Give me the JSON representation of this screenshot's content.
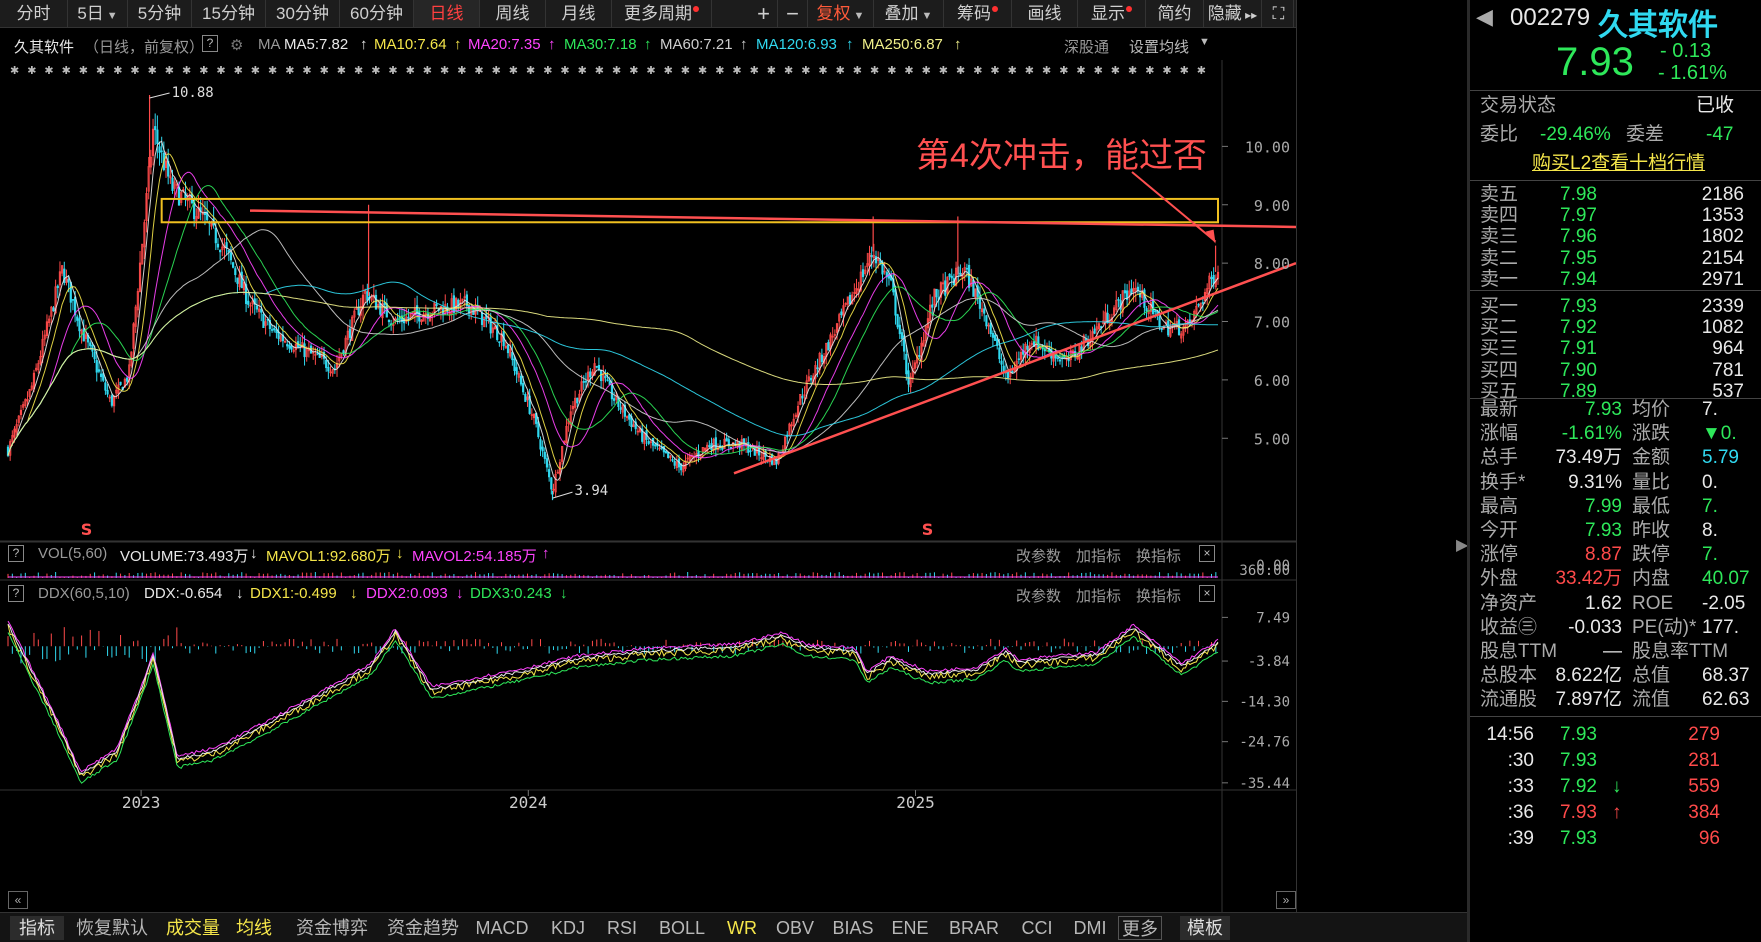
{
  "toolbar": {
    "periods": [
      "分时",
      "5日",
      "5分钟",
      "15分钟",
      "30分钟",
      "60分钟",
      "日线",
      "周线",
      "月线",
      "更多周期"
    ],
    "active": "日线",
    "tools": [
      "+",
      "−",
      "复权",
      "叠加",
      "筹码",
      "画线",
      "显示",
      "简约",
      "隐藏"
    ]
  },
  "legend": {
    "name": "久其软件",
    "mode": "（日线，前复权）",
    "help": "?",
    "ma_label": "MA",
    "ma5": "MA5:7.82",
    "ma10": "MA10:7.64",
    "ma20": "MA20:7.35",
    "ma30": "MA30:7.18",
    "ma60": "MA60:7.21",
    "ma120": "MA120:6.93",
    "ma250": "MA250:6.87",
    "up_arrow": "↑",
    "link1": "深股通",
    "link2": "设置均线"
  },
  "colors": {
    "ma5": "#e8e8e8",
    "ma10": "#f5e64a",
    "ma20": "#ff44ff",
    "ma30": "#2ee85a",
    "ma60": "#cfcfcf",
    "ma120": "#30d9f0",
    "ma250": "#f0f08a",
    "up": "#ff4a4a",
    "down": "#30d9f0",
    "annotation": "#ff5050",
    "box": "#f0c020"
  },
  "annotation": {
    "text": "第4次冲击，能过否",
    "high_label": "10.88",
    "low_label": "3.94",
    "event_marker": "S"
  },
  "price_axis": [
    "10.00",
    "9.00",
    "8.00",
    "7.00",
    "6.00",
    "5.00"
  ],
  "time_axis": [
    "2023",
    "2024",
    "2025"
  ],
  "vol_panel": {
    "help": "?",
    "name": "VOL(5,60)",
    "volume": "VOLUME:73.493万",
    "mavol1": "MAVOL1:92.680万",
    "mavol2": "MAVOL2:54.185万",
    "down_arrow": "↓",
    "up_arrow": "↑",
    "btn1": "改参数",
    "btn2": "加指标",
    "btn3": "换指标",
    "close": "×",
    "axis_top": "360.00",
    "axis_bottom": "0.00"
  },
  "ddx_panel": {
    "help": "?",
    "name": "DDX(60,5,10)",
    "ddx": "DDX:-0.654",
    "ddx1": "DDX1:-0.499",
    "ddx2": "DDX2:0.093",
    "ddx3": "DDX3:0.243",
    "down_arrow": "↓",
    "btn1": "改参数",
    "btn2": "加指标",
    "btn3": "换指标",
    "close": "×",
    "axis": [
      "7.49",
      "-3.84",
      "-14.30",
      "-24.76",
      "-35.44"
    ]
  },
  "bottom_tabs": [
    "指标",
    "恢复默认",
    "成交量",
    "均线",
    "资金博弈",
    "资金趋势",
    "MACD",
    "KDJ",
    "RSI",
    "BOLL",
    "WR",
    "OBV",
    "BIAS",
    "ENE",
    "BRAR",
    "CCI",
    "DMI",
    "更多"
  ],
  "bottom_right": "模板",
  "stock": {
    "code": "002279",
    "name": "久其软件",
    "price": "7.93",
    "change": "- 0.13",
    "change_pct": "- 1.61%"
  },
  "status": {
    "label1": "交易状态",
    "value1": "已收",
    "label2": "委比",
    "value2": "-29.46%",
    "label3": "委差",
    "value3": "-47",
    "l2_link": "购买L2查看十档行情"
  },
  "orderbook": {
    "asks": [
      {
        "label": "卖五",
        "price": "7.98",
        "vol": "2186"
      },
      {
        "label": "卖四",
        "price": "7.97",
        "vol": "1353"
      },
      {
        "label": "卖三",
        "price": "7.96",
        "vol": "1802"
      },
      {
        "label": "卖二",
        "price": "7.95",
        "vol": "2154"
      },
      {
        "label": "卖一",
        "price": "7.94",
        "vol": "2971"
      }
    ],
    "bids": [
      {
        "label": "买一",
        "price": "7.93",
        "vol": "2339"
      },
      {
        "label": "买二",
        "price": "7.92",
        "vol": "1082"
      },
      {
        "label": "买三",
        "price": "7.91",
        "vol": "964"
      },
      {
        "label": "买四",
        "price": "7.90",
        "vol": "781"
      },
      {
        "label": "买五",
        "price": "7.89",
        "vol": "537"
      }
    ]
  },
  "quote": [
    {
      "l1": "最新",
      "v1": "7.93",
      "c1": "green",
      "l2": "均价",
      "v2": "7.",
      "c2": "white"
    },
    {
      "l1": "涨幅",
      "v1": "-1.61%",
      "c1": "green",
      "l2": "涨跌",
      "v2": "▼0.",
      "c2": "green"
    },
    {
      "l1": "总手",
      "v1": "73.49万",
      "c1": "white",
      "l2": "金额",
      "v2": "5.79",
      "c2": "cyan"
    },
    {
      "l1": "换手*",
      "v1": "9.31%",
      "c1": "white",
      "l2": "量比",
      "v2": "0.",
      "c2": "white"
    },
    {
      "l1": "最高",
      "v1": "7.99",
      "c1": "green",
      "l2": "最低",
      "v2": "7.",
      "c2": "green"
    },
    {
      "l1": "今开",
      "v1": "7.93",
      "c1": "green",
      "l2": "昨收",
      "v2": "8.",
      "c2": "white"
    },
    {
      "l1": "涨停",
      "v1": "8.87",
      "c1": "red",
      "l2": "跌停",
      "v2": "7.",
      "c2": "green"
    },
    {
      "l1": "外盘",
      "v1": "33.42万",
      "c1": "red",
      "l2": "内盘",
      "v2": "40.07",
      "c2": "green"
    },
    {
      "l1": "净资产",
      "v1": "1.62",
      "c1": "white",
      "l2": "ROE",
      "v2": "-2.05",
      "c2": "white"
    },
    {
      "l1": "收益㊂",
      "v1": "-0.033",
      "c1": "white",
      "l2": "PE(动)*",
      "v2": "177.",
      "c2": "white"
    },
    {
      "l1": "股息TTM",
      "v1": "—",
      "c1": "white",
      "l2": "股息率TTM",
      "v2": "",
      "c2": "white"
    },
    {
      "l1": "总股本",
      "v1": "8.622亿",
      "c1": "white",
      "l2": "总值",
      "v2": "68.37",
      "c2": "white"
    },
    {
      "l1": "流通股",
      "v1": "7.897亿",
      "c1": "white",
      "l2": "流值",
      "v2": "62.63",
      "c2": "white"
    }
  ],
  "ticks": [
    {
      "time": "14:56",
      "price": "7.93",
      "vol": "279",
      "dir": ""
    },
    {
      "time": ":30",
      "price": "7.93",
      "vol": "281",
      "dir": ""
    },
    {
      "time": ":33",
      "price": "7.92",
      "vol": "559",
      "dir": "↓"
    },
    {
      "time": ":36",
      "price": "7.93",
      "vol": "384",
      "dir": "↑"
    },
    {
      "time": ":39",
      "price": "7.93",
      "vol": "96",
      "dir": ""
    }
  ],
  "chart_data": {
    "type": "candlestick",
    "title": "久其软件（日线，前复权）",
    "ylim": [
      3.6,
      11.0
    ],
    "x_labels": [
      "2023",
      "2024",
      "2025"
    ],
    "ohlc_anchors": [
      {
        "x": 0.0,
        "p": 4.8
      },
      {
        "x": 0.02,
        "p": 5.9
      },
      {
        "x": 0.045,
        "p": 7.9
      },
      {
        "x": 0.06,
        "p": 6.9
      },
      {
        "x": 0.085,
        "p": 5.6
      },
      {
        "x": 0.1,
        "p": 6.1
      },
      {
        "x": 0.115,
        "p": 9.2
      },
      {
        "x": 0.12,
        "p": 10.3
      },
      {
        "x": 0.135,
        "p": 9.3
      },
      {
        "x": 0.16,
        "p": 8.8
      },
      {
        "x": 0.18,
        "p": 8.2
      },
      {
        "x": 0.2,
        "p": 7.3
      },
      {
        "x": 0.22,
        "p": 6.8
      },
      {
        "x": 0.245,
        "p": 6.5
      },
      {
        "x": 0.27,
        "p": 6.2
      },
      {
        "x": 0.295,
        "p": 7.5
      },
      {
        "x": 0.32,
        "p": 7.0
      },
      {
        "x": 0.35,
        "p": 7.2
      },
      {
        "x": 0.38,
        "p": 7.3
      },
      {
        "x": 0.41,
        "p": 6.7
      },
      {
        "x": 0.435,
        "p": 5.3
      },
      {
        "x": 0.45,
        "p": 4.1
      },
      {
        "x": 0.465,
        "p": 5.5
      },
      {
        "x": 0.485,
        "p": 6.3
      },
      {
        "x": 0.5,
        "p": 5.7
      },
      {
        "x": 0.525,
        "p": 5.0
      },
      {
        "x": 0.555,
        "p": 4.5
      },
      {
        "x": 0.58,
        "p": 4.9
      },
      {
        "x": 0.605,
        "p": 4.9
      },
      {
        "x": 0.635,
        "p": 4.6
      },
      {
        "x": 0.655,
        "p": 5.7
      },
      {
        "x": 0.685,
        "p": 6.9
      },
      {
        "x": 0.715,
        "p": 8.2
      },
      {
        "x": 0.73,
        "p": 7.6
      },
      {
        "x": 0.745,
        "p": 5.9
      },
      {
        "x": 0.765,
        "p": 7.4
      },
      {
        "x": 0.79,
        "p": 7.9
      },
      {
        "x": 0.81,
        "p": 7.0
      },
      {
        "x": 0.825,
        "p": 6.0
      },
      {
        "x": 0.845,
        "p": 6.7
      },
      {
        "x": 0.875,
        "p": 6.3
      },
      {
        "x": 0.905,
        "p": 7.0
      },
      {
        "x": 0.93,
        "p": 7.6
      },
      {
        "x": 0.955,
        "p": 6.9
      },
      {
        "x": 0.975,
        "p": 6.9
      },
      {
        "x": 1.0,
        "p": 7.93
      }
    ],
    "resistance_box": {
      "top": 9.1,
      "bottom": 8.7
    },
    "support_line": {
      "from": [
        0.6,
        4.4
      ],
      "to": [
        1.28,
        8.0
      ]
    },
    "resistance_line": {
      "from": [
        0.2,
        8.9
      ],
      "to": [
        1.28,
        8.62
      ]
    },
    "ddx_ylim": [
      -36,
      12
    ]
  }
}
